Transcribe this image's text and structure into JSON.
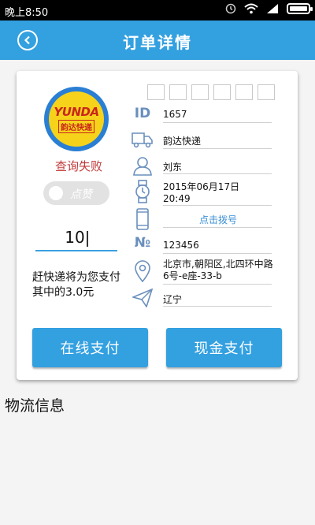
{
  "status_bar": {
    "time": "晚上8:50"
  },
  "header": {
    "title": "订单详情"
  },
  "courier": {
    "logo_text": "YUNDA",
    "logo_subtext": "韵达快递",
    "query_status": "查询失败",
    "like_label": "点赞"
  },
  "amount_input": {
    "value": "10"
  },
  "pay_note": "赶快递将为您支付其中的3.0元",
  "details": {
    "id": "1657",
    "company": "韵达快递",
    "person": "刘东",
    "date": "2015年06月17日",
    "time": "20:49",
    "call_label": "点击拨号",
    "number": "123456",
    "address": "北京市,朝阳区,北四环中路6号-e座-33-b",
    "destination": "辽宁"
  },
  "buttons": {
    "online_pay": "在线支付",
    "cash_pay": "现金支付"
  },
  "section": {
    "logistics_title": "物流信息"
  },
  "colors": {
    "accent": "#33a0e0",
    "fail": "#c23a3a",
    "icon": "#6a8fbd"
  }
}
